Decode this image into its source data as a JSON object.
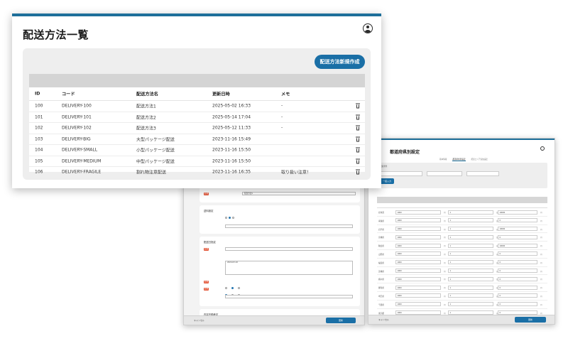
{
  "main": {
    "title": "配送方法一覧",
    "new_button": "配送方法新規作成",
    "columns": [
      "ID",
      "コード",
      "配送方法名",
      "更新日時",
      "メモ"
    ],
    "rows": [
      {
        "id": "100",
        "code": "DELIVERY-100",
        "name": "配送方法1",
        "updated": "2025-05-02 16:33",
        "memo": "-"
      },
      {
        "id": "101",
        "code": "DELIVERY-101",
        "name": "配送方法2",
        "updated": "2025-05-14 17:04",
        "memo": "-"
      },
      {
        "id": "102",
        "code": "DELIVERY-102",
        "name": "配送方法3",
        "updated": "2025-05-12 11:33",
        "memo": "-"
      },
      {
        "id": "103",
        "code": "DELIVERY-BIG",
        "name": "大型パッケージ配送",
        "updated": "2023-11-16 15:49",
        "memo": ""
      },
      {
        "id": "104",
        "code": "DELIVERY-SMALL",
        "name": "小型パッケージ配送",
        "updated": "2023-11-16 15:50",
        "memo": ""
      },
      {
        "id": "105",
        "code": "DELIVERY-MEDIUM",
        "name": "中型パッケージ配送",
        "updated": "2023-11-16 15:50",
        "memo": ""
      },
      {
        "id": "106",
        "code": "DELIVERY-FRAGILE",
        "name": "割れ物注意配送",
        "updated": "2023-11-16 16:35",
        "memo": "取り扱い注意！"
      }
    ],
    "icons": {
      "user": "user-circle-icon",
      "delete": "trash-icon"
    },
    "accent_color": "#1e6f9a",
    "button_color": "#1a6fa6"
  },
  "editor": {
    "name_value": "配送方法1",
    "section_fee": "送料設定",
    "section_delivery": "配送日指定",
    "section_delivery_time": "内容不動産定",
    "date_value": "2024-03-10",
    "cancel": "キャンセル",
    "save": "更新"
  },
  "prefecture": {
    "title": "都道府県別設定",
    "tabs": [
      "基本情報",
      "都道府県別設定",
      "配送エリア追加設定"
    ],
    "filter_heading": "検索条件",
    "search_button": "一括入力",
    "prefectures": [
      "北海道",
      "青森県",
      "岩手県",
      "宮城県",
      "秋田県",
      "山形県",
      "福島県",
      "茨城県",
      "栃木県",
      "群馬県",
      "埼玉県",
      "千葉県",
      "東京都"
    ],
    "fee_values": [
      "1000",
      "1000",
      "1000",
      "1000",
      "1000",
      "1000",
      "1000",
      "1000",
      "1000",
      "1000",
      "1000",
      "1000",
      "1000"
    ],
    "days_values": [
      "1",
      "1",
      "1",
      "1",
      "1",
      "1",
      "1",
      "1",
      "1",
      "1",
      "1",
      "1",
      "1"
    ],
    "free_values": [
      "10000",
      "0",
      "10000",
      "0",
      "10000",
      "0",
      "0",
      "0",
      "0",
      "0",
      "0",
      "0",
      "0"
    ],
    "unit_yen": "円",
    "unit_day": "日",
    "cancel": "キャンセル",
    "save": "更新"
  }
}
